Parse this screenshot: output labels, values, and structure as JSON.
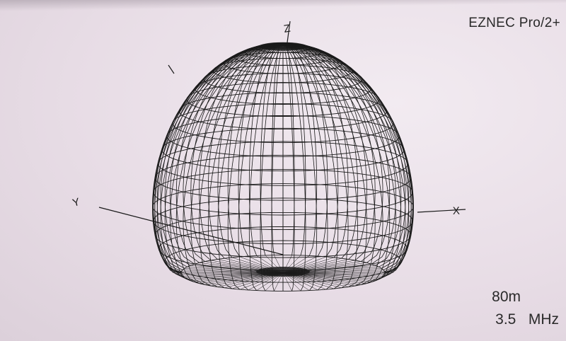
{
  "program_name": "EZNEC Pro/2+",
  "band": "80m",
  "frequency": "3.5   MHz",
  "axes": {
    "z_label": "Z",
    "y_label": "Y",
    "x_label": "X"
  },
  "view": {
    "type": "3D far-field radiation pattern",
    "render_style": "wireframe mesh",
    "pattern_shape": "dome"
  },
  "colors": {
    "background": "#e9dfe6",
    "mesh": "#1a1a1a",
    "text": "#2a2a2a"
  }
}
